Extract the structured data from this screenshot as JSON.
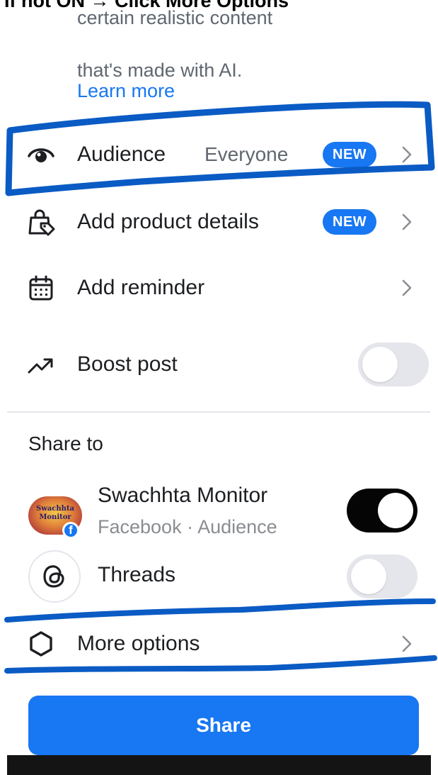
{
  "top_caption": "If not ON → Click More Options",
  "ai_notice": {
    "line1": "certain realistic content",
    "line2": "that's made with AI.",
    "learn_more": "Learn more"
  },
  "settings": {
    "audience": {
      "label": "Audience",
      "value": "Everyone",
      "badge": "NEW"
    },
    "product": {
      "label": "Add product details",
      "badge": "NEW"
    },
    "reminder": {
      "label": "Add reminder"
    },
    "boost": {
      "label": "Boost post",
      "toggle_on": false
    }
  },
  "share_to": {
    "heading": "Share to",
    "accounts": [
      {
        "name": "Swachhta Monitor",
        "subtitle": "Facebook · Audience",
        "avatar_text": "Swachhta Monitor",
        "platform_badge": "f",
        "toggle_on": true
      },
      {
        "name": "Threads",
        "toggle_on": false
      }
    ]
  },
  "more_options": {
    "label": "More options"
  },
  "share_button": {
    "label": "Share"
  },
  "colors": {
    "accent": "#1877f2",
    "annotation": "#0a5bc4",
    "toggle_on": "#050505",
    "toggle_off": "#e4e6eb"
  }
}
